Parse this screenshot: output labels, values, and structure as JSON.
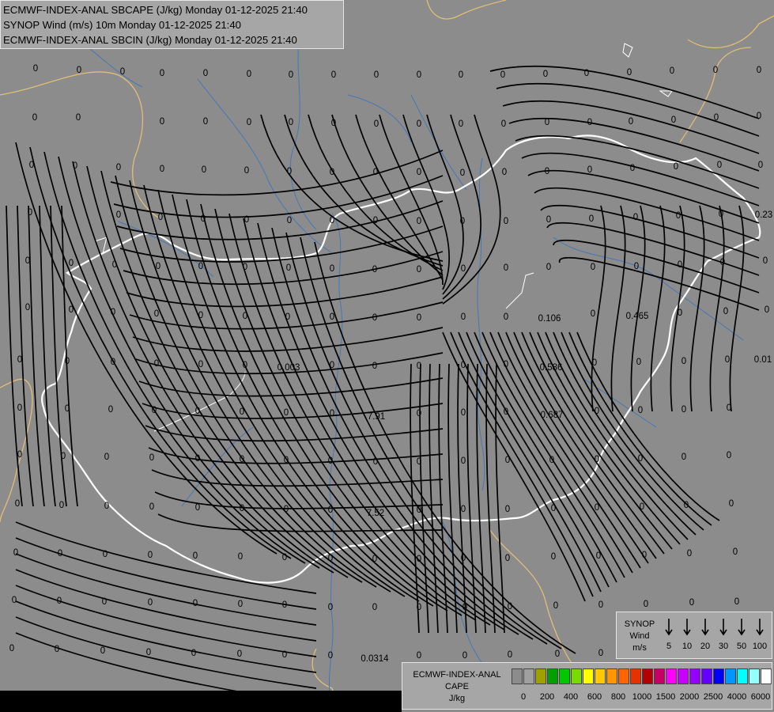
{
  "title_lines": [
    "ECMWF-INDEX-ANAL SBCAPE (J/kg) Monday 01-12-2025 21:40",
    "SYNOP Wind (m/s) 10m Monday 01-12-2025 21:40",
    "ECMWF-INDEX-ANAL SBCIN (J/kg) Monday 01-12-2025 21:40"
  ],
  "wind_legend": {
    "title_lines": [
      "SYNOP",
      "Wind",
      "m/s"
    ],
    "speeds": [
      "5",
      "10",
      "20",
      "30",
      "50",
      "100"
    ]
  },
  "cape_legend": {
    "title_lines": [
      "ECMWF-INDEX-ANAL",
      "CAPE",
      "J/kg"
    ],
    "colors": [
      "#8c8c8c",
      "#a0a0a0",
      "#a0a000",
      "#00a000",
      "#00c800",
      "#78dc00",
      "#ffff00",
      "#ffc800",
      "#ff9600",
      "#ff6400",
      "#e63200",
      "#b40000",
      "#c80064",
      "#ff00ff",
      "#c800ff",
      "#9600ff",
      "#6400ff",
      "#0000ff",
      "#0096ff",
      "#00ffff",
      "#96ffff",
      "#ffffff"
    ],
    "ticks": [
      "0",
      "200",
      "400",
      "600",
      "800",
      "1000",
      "1500",
      "2000",
      "2500",
      "4000",
      "6000"
    ]
  },
  "map_values": [
    "0",
    "0",
    "0",
    "0",
    "0",
    "0",
    "0",
    "0",
    "0",
    "0",
    "0",
    "0",
    "0",
    "0",
    "0",
    "0",
    "0",
    "0",
    "0",
    "0",
    "0.003",
    "7.91",
    "7.52",
    "0.106",
    "0.465",
    "0.586",
    "0.687",
    "0.0314",
    "0.01",
    "0.23"
  ],
  "colors": {
    "background": "#8c8c8c",
    "border": "#ffffff",
    "neighbor_border": "#e1be78",
    "river": "#4678b4",
    "streamline": "#000000"
  }
}
